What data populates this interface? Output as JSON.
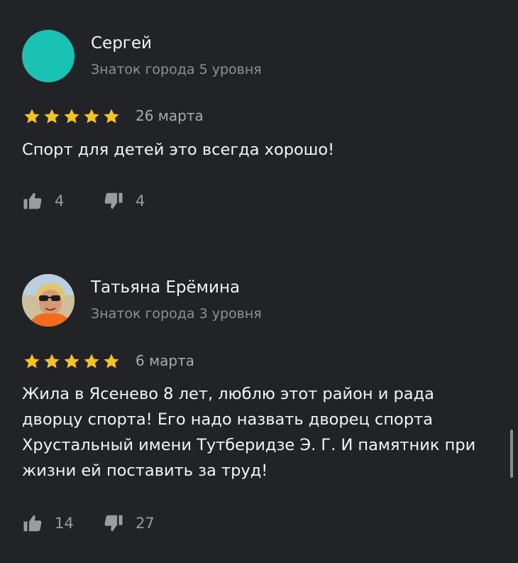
{
  "reviews": [
    {
      "author": "Сергей",
      "level": "Знаток города 5 уровня",
      "rating": 5,
      "date": "26 марта",
      "text": "Спорт для детей это всегда хорошо!",
      "likes": "4",
      "dislikes": "4"
    },
    {
      "author": "Татьяна Ерёмина",
      "level": "Знаток города 3 уровня",
      "rating": 5,
      "date": "6 марта",
      "text": "Жила в Ясенево 8 лет, люблю этот район и рада дворцу спорта! Его надо назвать дворец спорта Хрустальный имени Тутберидзе Э. Г. И памятник при жизни ей поставить за труд!",
      "likes": "14",
      "dislikes": "27"
    }
  ],
  "colors": {
    "background": "#222327",
    "star": "#f8c31d",
    "avatar_teal": "#19c2b3",
    "secondary_text": "#8e9095"
  }
}
